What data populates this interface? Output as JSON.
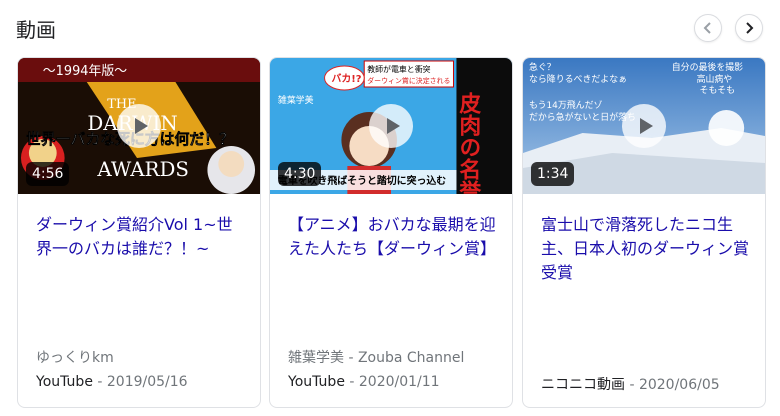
{
  "section": {
    "title": "動画"
  },
  "nav": {
    "prev_icon": "chevron-left-icon",
    "next_icon": "chevron-right-icon"
  },
  "videos": [
    {
      "duration": "4:56",
      "title": "ダーウィン賞紹介Vol 1~世界一のバカは誰だ？！~",
      "channel": "ゆっくりkm",
      "source": "YouTube",
      "date": "2019/05/16",
      "thumb": {
        "top_label": "〜1994年版〜",
        "big1": "THE",
        "big2": "DARWIN",
        "big3": "AWARDS",
        "caption": "世界一バカな死に方は何だ！？"
      }
    },
    {
      "duration": "4:30",
      "title": "【アニメ】おバカな最期を迎えた人たち【ダーウィン賞】",
      "channel": "雑葉学美 - Zouba Channel",
      "source": "YouTube",
      "date": "2020/01/11",
      "thumb": {
        "bubble1": "教師が電車と衝突",
        "bubble2": "ダーウィン賞に決定される",
        "shout": "バカ!?",
        "side": "皮肉の名誉",
        "bottom": "電車を吹き飛ばそうと踏切に突っ込む",
        "tag": "雑葉学美"
      }
    },
    {
      "duration": "1:34",
      "title": "富士山で滑落死したニコ生主、日本人初のダーウィン賞受賞",
      "channel": "",
      "source": "ニコニコ動画",
      "date": "2020/06/05",
      "thumb": {
        "c1": "急ぐ？",
        "c2": "なら降りるべきだよなぁ",
        "c3": "自分の最後を撮影",
        "c4": "高山病や",
        "c5": "そもそも",
        "c6": "もう14万飛んだゾ",
        "c7": "だから急がないと日が落ち"
      }
    }
  ],
  "colors": {
    "link": "#1a0dab",
    "meta": "#70757a",
    "border": "#dfe1e5"
  }
}
